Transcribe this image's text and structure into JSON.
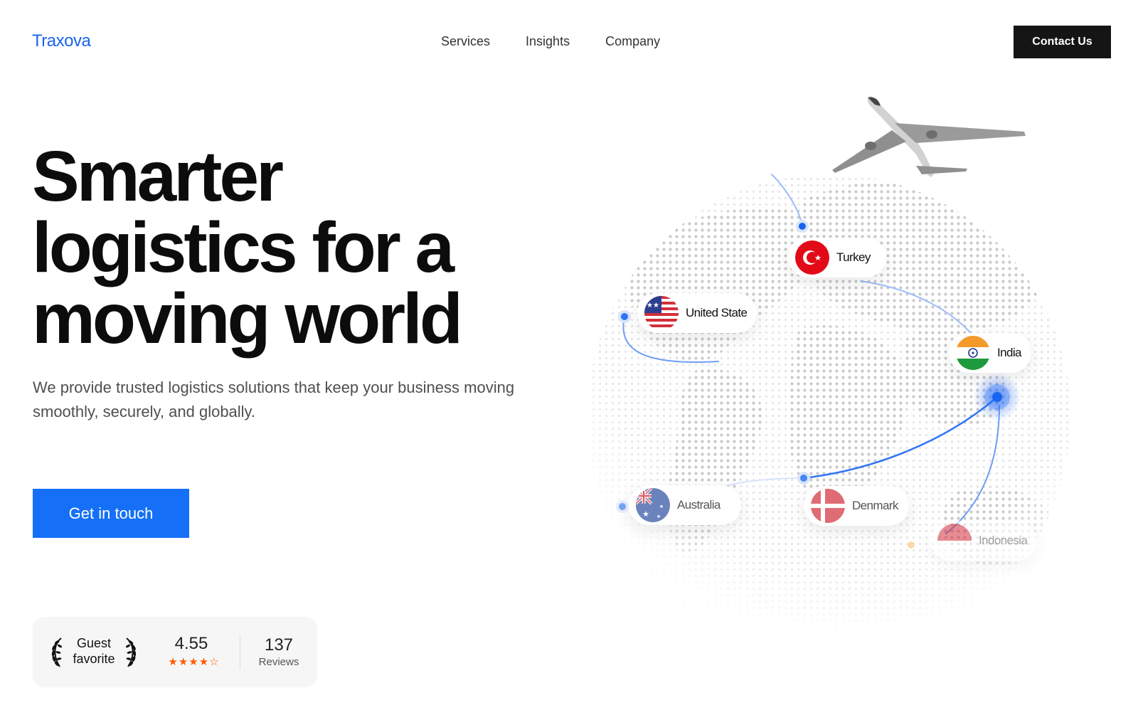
{
  "nav": {
    "logo": "Traxova",
    "links": [
      "Services",
      "Insights",
      "Company"
    ],
    "contact_label": "Contact Us"
  },
  "hero": {
    "title_lines": [
      "Smarter",
      "logistics for a",
      "moving world"
    ],
    "subtitle": "We provide trusted logistics solutions that keep your business moving smoothly, securely, and globally.",
    "cta_label": "Get in touch"
  },
  "rating": {
    "badge": "Guest favorite",
    "score": "4.55",
    "stars_filled": 4,
    "stars_total": 5,
    "review_count": "137",
    "review_label": "Reviews"
  },
  "map": {
    "locations": [
      {
        "name": "Turkey",
        "flag": "turkey-flag-icon"
      },
      {
        "name": "United State",
        "flag": "usa-flag-icon"
      },
      {
        "name": "India",
        "flag": "india-flag-icon"
      },
      {
        "name": "Australia",
        "flag": "australia-flag-icon"
      },
      {
        "name": "Denmark",
        "flag": "denmark-flag-icon"
      },
      {
        "name": "Indonesia",
        "flag": "indonesia-flag-icon"
      }
    ]
  },
  "colors": {
    "brand": "#1a63f0",
    "cta": "#1570f7",
    "dark_button": "#151515",
    "star": "#ff5a00",
    "route": "#2f74f5"
  }
}
